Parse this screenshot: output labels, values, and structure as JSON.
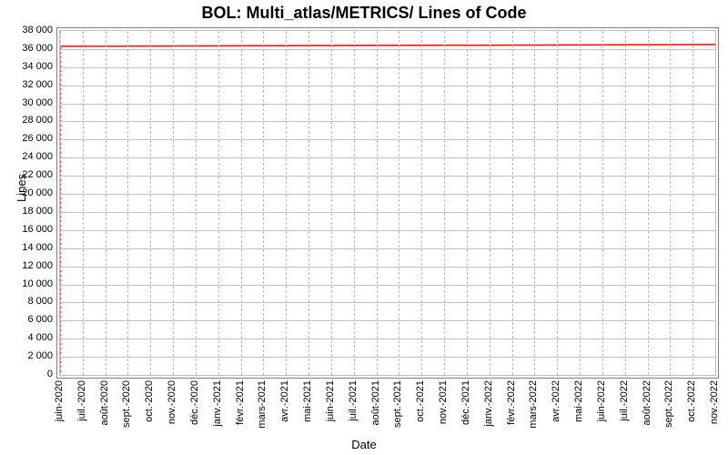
{
  "chart_data": {
    "type": "line",
    "title": "BOL: Multi_atlas/METRICS/ Lines of Code",
    "xlabel": "Date",
    "ylabel": "Lines",
    "ylim": [
      0,
      38000
    ],
    "y_ticks": [
      0,
      2000,
      4000,
      6000,
      8000,
      10000,
      12000,
      14000,
      16000,
      18000,
      20000,
      22000,
      24000,
      26000,
      28000,
      30000,
      32000,
      34000,
      36000,
      38000
    ],
    "y_tick_labels": [
      "0",
      "2 000",
      "4 000",
      "6 000",
      "8 000",
      "10 000",
      "12 000",
      "14 000",
      "16 000",
      "18 000",
      "20 000",
      "22 000",
      "24 000",
      "26 000",
      "28 000",
      "30 000",
      "32 000",
      "34 000",
      "36 000",
      "38 000"
    ],
    "x_categories": [
      "juin-2020",
      "juil.-2020",
      "août-2020",
      "sept.-2020",
      "oct.-2020",
      "nov.-2020",
      "déc.-2020",
      "janv.-2021",
      "févr.-2021",
      "mars-2021",
      "avr.-2021",
      "mai-2021",
      "juin-2021",
      "juil.-2021",
      "août-2021",
      "sept.-2021",
      "oct.-2021",
      "nov.-2021",
      "déc.-2021",
      "janv.-2022",
      "févr.-2022",
      "mars-2022",
      "avr.-2022",
      "mai-2022",
      "juin-2022",
      "juil.-2022",
      "août-2022",
      "sept.-2022",
      "oct.-2022",
      "nov.-2022"
    ],
    "series": [
      {
        "name": "Lines of Code",
        "color": "#ff0000",
        "x": [
          "juin-2020",
          "juin-2020",
          "nov.-2022"
        ],
        "y": [
          0,
          36300,
          36500
        ]
      }
    ]
  }
}
